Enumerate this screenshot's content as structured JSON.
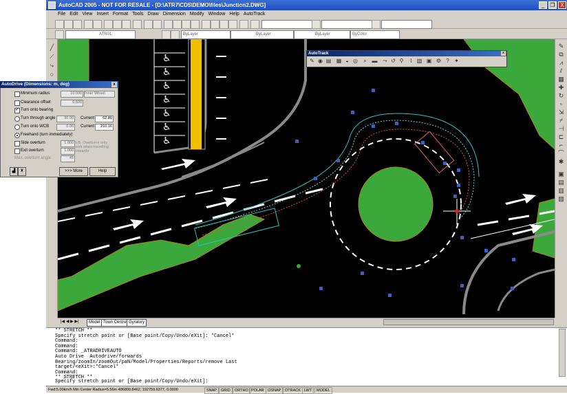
{
  "window": {
    "title": "AutoCAD 2005 - NOT FOR RESALE - [D:\\ATR7\\CD5\\DEMO\\files\\Junction2.DWG]",
    "minimize": "_",
    "restore": "❐",
    "close": "X"
  },
  "menu": [
    "File",
    "Edit",
    "View",
    "Insert",
    "Format",
    "Tools",
    "Draw",
    "Dimension",
    "Modify",
    "Window",
    "Help",
    "AutoTrack"
  ],
  "layer_toolbar": {
    "layer": "ATR01",
    "color": "ByLayer",
    "linetype": "ByLayer",
    "lineweight": "ByLayer",
    "plotstyle": "ByColor"
  },
  "autotrack": {
    "title": "AutoTrack",
    "close": "x",
    "icons": [
      "pencil-icon",
      "drive-icon",
      "table-icon",
      "vehicle-icon",
      "arc-icon",
      "swept-icon",
      "zoom-icon",
      "truck-icon",
      "path-icon",
      "turn-icon",
      "link-icon",
      "profile-icon",
      "park-icon",
      "report-icon",
      "settings-icon",
      "help-icon",
      "info-icon"
    ]
  },
  "autodrive": {
    "title": "AutoDrive  (Dimensions: m, deg)",
    "close": "x",
    "minimum_radius_label": "Minimum radius",
    "minimum_radius_value": "10.000",
    "wheel_select": "Inner Wheel",
    "clearance_label": "Clearance offset",
    "clearance_value": "0.500",
    "turn_onto_bearing_label": "Turn onto bearing",
    "turn_through_label": "Turn through angle",
    "turn_through_value": "90.00",
    "current1_label": "Current",
    "current1_value": "62.80",
    "turn_onto_wcb_label": "Turn onto WCB",
    "turn_onto_wcb_value": "0.00",
    "current2_label": "Current",
    "current2_value": "210.16",
    "freehand_label": "Freehand (turn immediately)",
    "side_overturn_label": "Side overturn",
    "side_overturn_value": "1.000",
    "exit_overturn_label": "Exit overturn",
    "exit_overturn_value": "1.000",
    "max_overturn_label": "Max. overturn angle",
    "max_overturn_value": "45",
    "note": "N.B. Overturns only work when travelling forwards",
    "more_button": ">>> More",
    "help_button": "Help"
  },
  "tabs": [
    "Model",
    "Town Centre",
    "Gyratory"
  ],
  "command_lines": [
    "** STRETCH **",
    "Specify stretch point or [Base point/Copy/Undo/eXit]: *Cancel*",
    "Command:",
    "Command:",
    "Command: _ATRADRIVEAUTO",
    "Auto Drive  Autodrive/forwards",
    "Bearing/zoomIn/zoomOut/paN/Model/Properties/Reports/remove Last",
    "target/<eXit>:*Cancel*",
    "Command:",
    "** STRETCH **"
  ],
  "command_input": "Specify stretch point or [Base point/Copy/Undo/eXit]:",
  "status": {
    "readout": "Fwd:5.00km/h Min Center Radius=5.56m  486800.8462, 192759.6377, 0.0000",
    "buttons": [
      "SNAP",
      "GRID",
      "ORTHO",
      "POLAR",
      "OSNAP",
      "OTRACK",
      "LWT",
      "MODEL"
    ]
  },
  "colors": {
    "green": "#3aa83a",
    "road": "#000000",
    "curb": "#8a8a8a",
    "marker": "#3a5fcd"
  }
}
